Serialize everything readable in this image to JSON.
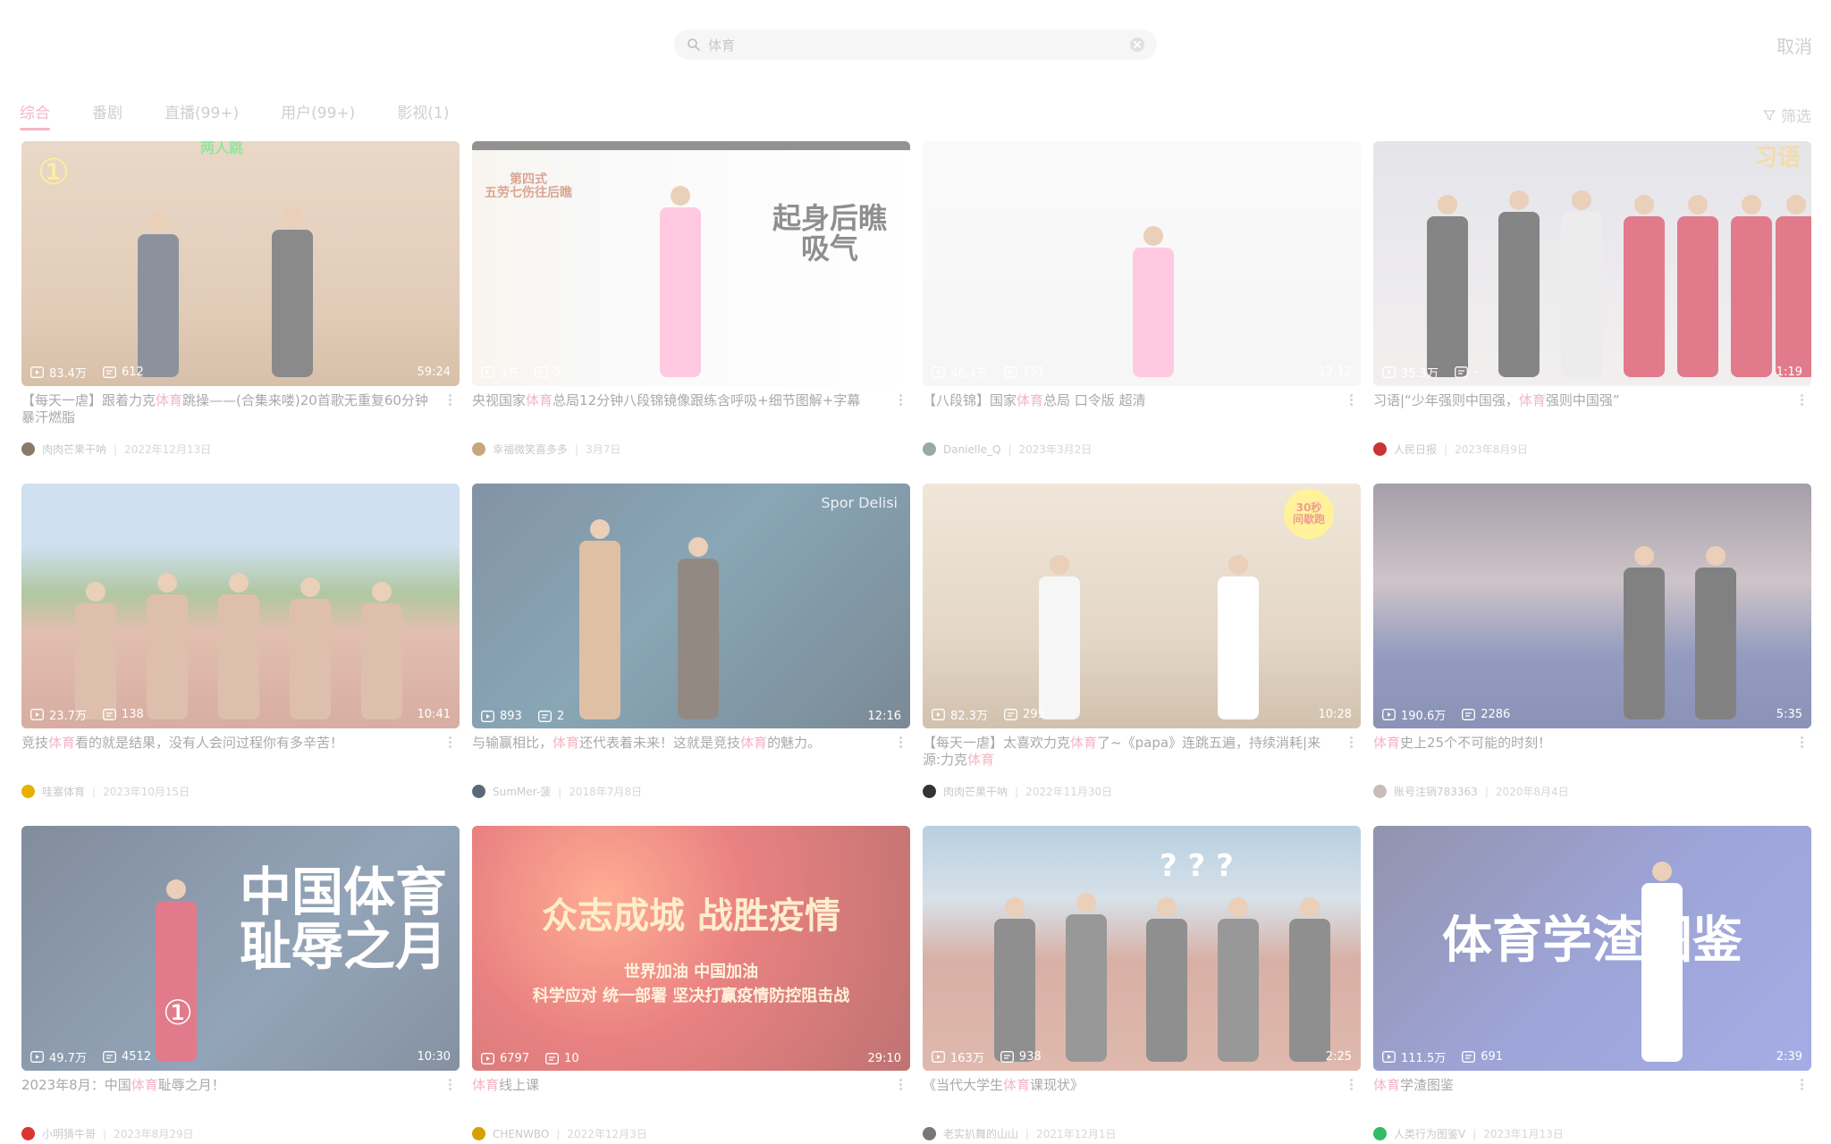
{
  "search": {
    "query": "体育",
    "cancel_label": "取消"
  },
  "tabs": [
    {
      "label": "综合",
      "active": true
    },
    {
      "label": "番剧",
      "active": false
    },
    {
      "label": "直播(99+)",
      "active": false
    },
    {
      "label": "用户(99+)",
      "active": false
    },
    {
      "label": "影视(1)",
      "active": false
    }
  ],
  "filter_label": "筛选",
  "colors": {
    "accent": "#f6b6c6",
    "text": "#a9a9a9",
    "muted": "#c9c9c9"
  },
  "videos": [
    {
      "title_parts": [
        "【每天一虐】跟着力克",
        "体育",
        "跳操——(合集来喽)20首歌无重复60分钟暴汗燃脂"
      ],
      "views": "83.4万",
      "comments": "612",
      "duration": "59:24",
      "author": "肉肉芒果干呐",
      "date": "2022年12月13日",
      "thumb_badge": "①",
      "thumb_text": "两人跳"
    },
    {
      "title_parts": [
        "央视国家",
        "体育",
        "总局12分钟八段锦镜像跟练含呼吸+细节图解+字幕"
      ],
      "views": "9万",
      "comments": "5",
      "duration": "12:00",
      "author": "幸福微笑喜多多",
      "date": "3月7日",
      "thumb_text": "起身后瞧\n吸气",
      "thumb_side": "第四式\n五劳七伤往后瞧"
    },
    {
      "title_parts": [
        "【八段锦】国家",
        "体育",
        "总局  口令版  超清"
      ],
      "views": "46.4万",
      "comments": "151",
      "duration": "12:12",
      "author": "Danielle_Q",
      "date": "2023年3月2日"
    },
    {
      "title_parts": [
        "习语|“少年强则中国强，",
        "体育",
        "强则中国强”"
      ],
      "views": "35.3万",
      "comments": "-",
      "duration": "1:19",
      "author": "人民日报",
      "date": "2023年8月9日",
      "thumb_badge": "习语"
    },
    {
      "title_parts": [
        "竞技",
        "体育",
        "看的就是结果，没有人会问过程你有多辛苦！"
      ],
      "views": "23.7万",
      "comments": "138",
      "duration": "10:41",
      "author": "哇塞体育",
      "date": "2023年10月15日"
    },
    {
      "title_parts": [
        "与输赢相比，",
        "体育",
        "还代表着未来！这就是竞技",
        "体育",
        "的魅力。"
      ],
      "views": "893",
      "comments": "2",
      "duration": "12:16",
      "author": "SumMer-菠",
      "date": "2018年7月8日",
      "thumb_badge": "Spor Delisi"
    },
    {
      "title_parts": [
        "【每天一虐】太喜欢力克",
        "体育",
        "了~《papa》连跳五遍，持续消耗|来源:力克",
        "体育"
      ],
      "views": "82.3万",
      "comments": "295",
      "duration": "10:28",
      "author": "肉肉芒果干呐",
      "date": "2022年11月30日",
      "thumb_badge": "30秒\n间歇跑"
    },
    {
      "title_parts": [
        "体育",
        "史上25个不可能的时刻！"
      ],
      "views": "190.6万",
      "comments": "2286",
      "duration": "5:35",
      "author": "账号注销783363",
      "date": "2020年8月4日"
    },
    {
      "title_parts": [
        "2023年8月：中国",
        "体育",
        "耻辱之月！"
      ],
      "views": "49.7万",
      "comments": "4512",
      "duration": "10:30",
      "author": "小明猜牛哥",
      "date": "2023年8月29日",
      "thumb_text": "中国体育\n耻辱之月",
      "thumb_badge": "①"
    },
    {
      "title_parts": [
        "体育",
        "线上课"
      ],
      "views": "6797",
      "comments": "10",
      "duration": "29:10",
      "author": "CHENWBO",
      "date": "2022年12月3日",
      "thumb_text": "众志成城 战胜疫情",
      "thumb_sub": "世界加油 中国加油\n科学应对 统一部署 坚决打赢疫情防控阻击战"
    },
    {
      "title_parts": [
        "《当代大学生",
        "体育",
        "课现状》"
      ],
      "views": "163万",
      "comments": "938",
      "duration": "2:25",
      "author": "老实扒舞的山山",
      "date": "2021年12月1日",
      "thumb_badge": "? ? ?"
    },
    {
      "title_parts": [
        "体育",
        "学渣图鉴"
      ],
      "views": "111.5万",
      "comments": "691",
      "duration": "2:39",
      "author": "人类行为图鉴V",
      "date": "2023年1月13日",
      "thumb_text": "体育学渣图鉴"
    }
  ]
}
